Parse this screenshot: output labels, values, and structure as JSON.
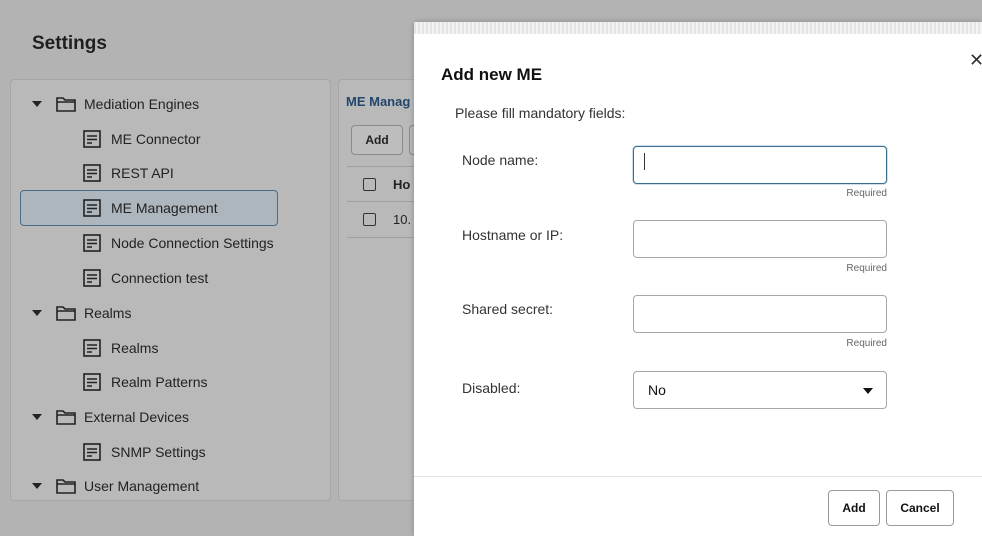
{
  "page": {
    "title": "Settings"
  },
  "tree": {
    "items": [
      {
        "type": "folder",
        "label": "Mediation Engines"
      },
      {
        "type": "doc",
        "label": "ME Connector"
      },
      {
        "type": "doc",
        "label": "REST API"
      },
      {
        "type": "doc",
        "label": "ME Management",
        "selected": true
      },
      {
        "type": "doc",
        "label": "Node Connection Settings"
      },
      {
        "type": "doc",
        "label": "Connection test"
      },
      {
        "type": "folder",
        "label": "Realms"
      },
      {
        "type": "doc",
        "label": "Realms"
      },
      {
        "type": "doc",
        "label": "Realm Patterns"
      },
      {
        "type": "folder",
        "label": "External Devices"
      },
      {
        "type": "doc",
        "label": "SNMP Settings"
      },
      {
        "type": "folder",
        "label": "User Management"
      }
    ]
  },
  "content": {
    "breadcrumb": "ME Manag",
    "add_label": "Add",
    "column_header": "Ho",
    "row_value": "10."
  },
  "modal": {
    "close_icon": "close-icon",
    "title": "Add new ME",
    "subtitle": "Please fill mandatory fields:",
    "fields": {
      "node_name": {
        "label": "Node name:",
        "value": "",
        "hint": "Required"
      },
      "hostname": {
        "label": "Hostname or IP:",
        "value": "",
        "hint": "Required"
      },
      "shared_secret": {
        "label": "Shared secret:",
        "value": "",
        "hint": "Required"
      },
      "disabled": {
        "label": "Disabled:",
        "value": "No"
      }
    },
    "add_label": "Add",
    "cancel_label": "Cancel"
  },
  "colors": {
    "accent": "#3a6e8c",
    "overlay": "#b3b3b3"
  }
}
